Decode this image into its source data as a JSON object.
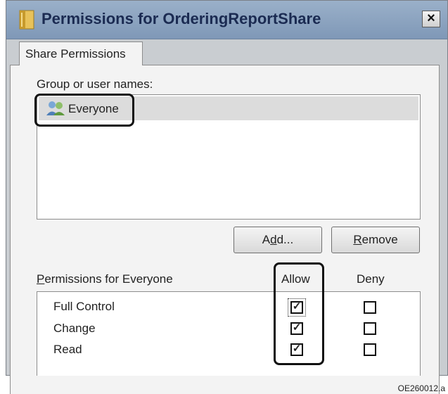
{
  "window": {
    "title": "Permissions for OrderingReportShare",
    "close_glyph": "×"
  },
  "tabs": [
    {
      "label": "Share Permissions",
      "active": true
    }
  ],
  "group_section": {
    "label": "Group or user names:",
    "users": [
      {
        "name": "Everyone",
        "icon": "users-icon",
        "selected": true
      }
    ]
  },
  "buttons": {
    "add": {
      "pre": "A",
      "accel": "d",
      "post": "d..."
    },
    "remove": {
      "accel": "R",
      "post": "emove"
    }
  },
  "permissions_section": {
    "label_accel": "P",
    "label_rest": "ermissions for Everyone",
    "allow_header": "Allow",
    "deny_header": "Deny",
    "rows": [
      {
        "name": "Full Control",
        "allow": true,
        "deny": false
      },
      {
        "name": "Change",
        "allow": true,
        "deny": false
      },
      {
        "name": "Read",
        "allow": true,
        "deny": false
      }
    ]
  },
  "figure_code": "OE260012.a",
  "colors": {
    "titlebar": "#8ea5c1",
    "title_text": "#1b2b52",
    "panel": "#f3f3f3",
    "window_frame": "#c9cdd1",
    "highlight": "#111111"
  }
}
